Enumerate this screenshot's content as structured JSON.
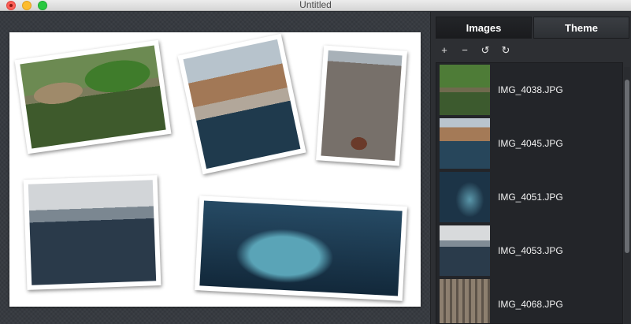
{
  "window": {
    "title": "Untitled"
  },
  "sidebar": {
    "tabs": [
      {
        "label": "Images",
        "active": true
      },
      {
        "label": "Theme",
        "active": false
      }
    ],
    "toolbar": [
      {
        "icon": "plus-icon",
        "glyph": "+"
      },
      {
        "icon": "minus-icon",
        "glyph": "−"
      },
      {
        "icon": "rotate-left-icon",
        "glyph": "↺"
      },
      {
        "icon": "rotate-right-icon",
        "glyph": "↻"
      }
    ],
    "images": [
      {
        "name": "IMG_4038.JPG"
      },
      {
        "name": "IMG_4045.JPG"
      },
      {
        "name": "IMG_4051.JPG"
      },
      {
        "name": "IMG_4053.JPG"
      },
      {
        "name": "IMG_4068.JPG"
      }
    ]
  }
}
